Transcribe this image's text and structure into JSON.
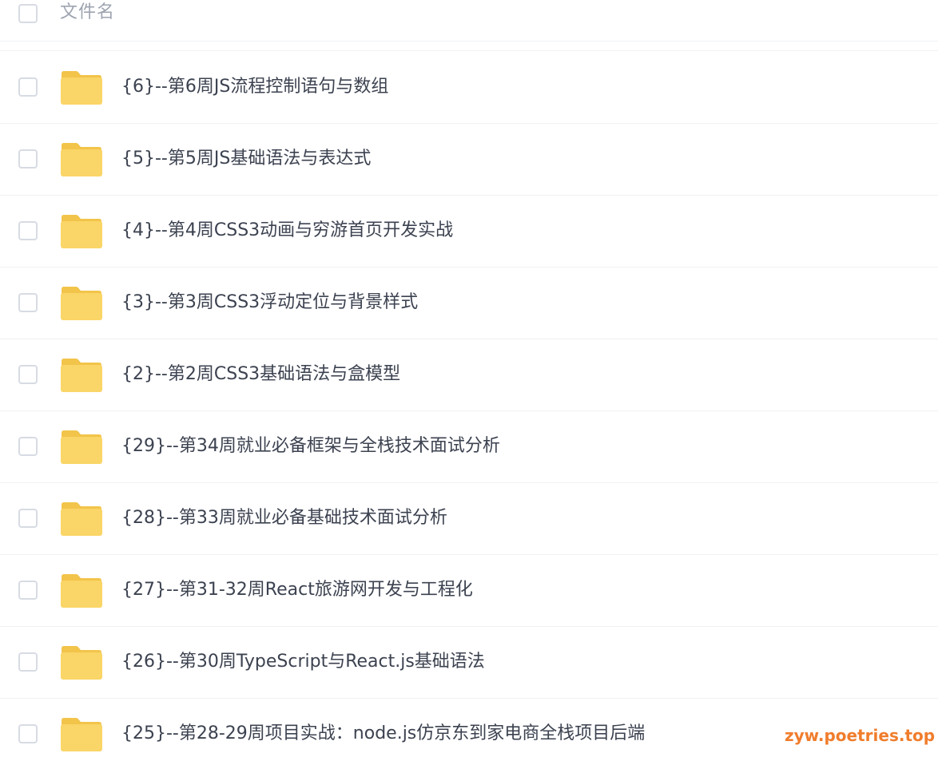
{
  "header": {
    "column_label": "文件名"
  },
  "colors": {
    "folder_body": "#FAD567",
    "folder_tab": "#F2C44A",
    "text": "#3C4250",
    "header_text": "#9EA4B0",
    "divider": "#F0F1F4",
    "checkbox_border": "#D7DBE3",
    "watermark": "#F07D2C"
  },
  "files": [
    {
      "name": "{6}--第6周JS流程控制语句与数组",
      "icon": "folder-icon"
    },
    {
      "name": "{5}--第5周JS基础语法与表达式",
      "icon": "folder-icon"
    },
    {
      "name": "{4}--第4周CSS3动画与穷游首页开发实战",
      "icon": "folder-icon"
    },
    {
      "name": "{3}--第3周CSS3浮动定位与背景样式",
      "icon": "folder-icon"
    },
    {
      "name": "{2}--第2周CSS3基础语法与盒模型",
      "icon": "folder-icon"
    },
    {
      "name": "{29}--第34周就业必备框架与全栈技术面试分析",
      "icon": "folder-icon"
    },
    {
      "name": "{28}--第33周就业必备基础技术面试分析",
      "icon": "folder-icon"
    },
    {
      "name": "{27}--第31-32周React旅游网开发与工程化",
      "icon": "folder-icon"
    },
    {
      "name": "{26}--第30周TypeScript与React.js基础语法",
      "icon": "folder-icon"
    },
    {
      "name": "{25}--第28-29周项目实战：node.js仿京东到家电商全栈项目后端",
      "icon": "folder-icon"
    }
  ],
  "watermark": "zyw.poetries.top"
}
